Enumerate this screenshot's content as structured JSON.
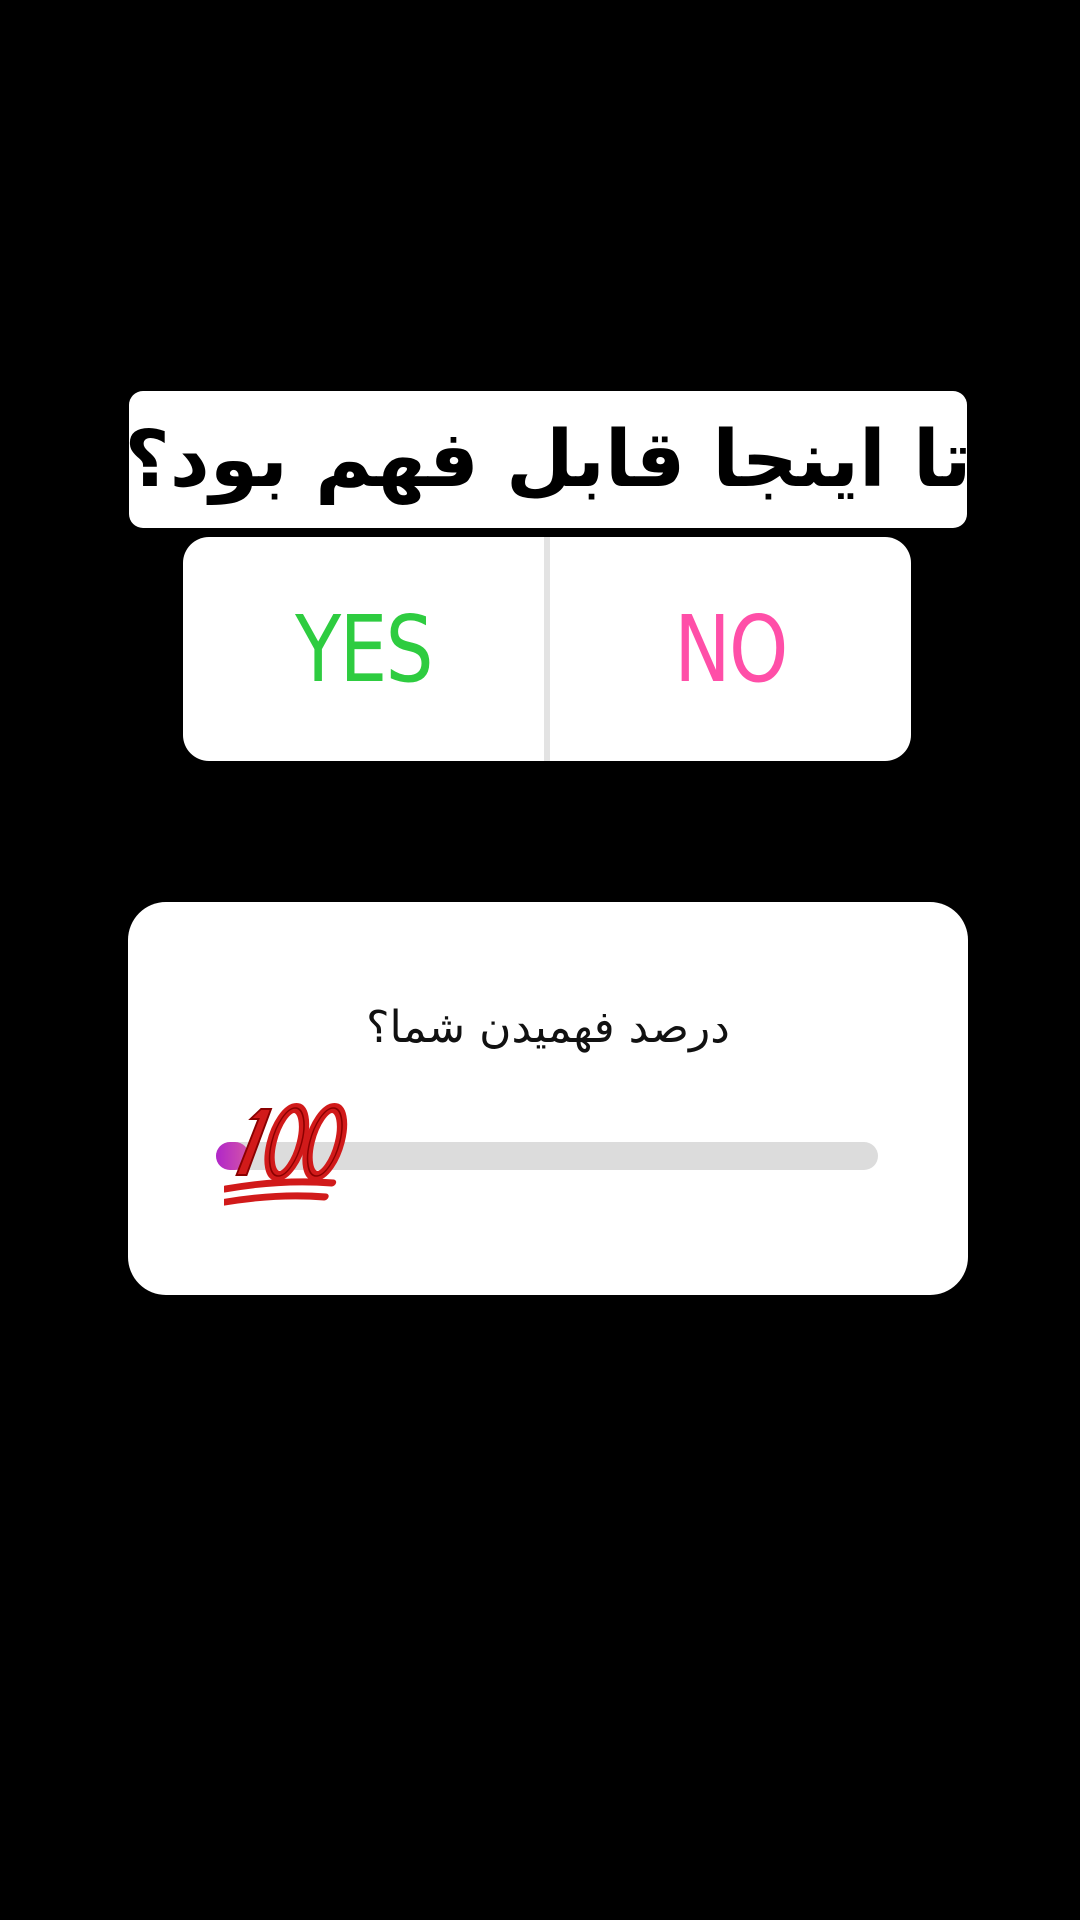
{
  "question": {
    "text": "تا اینجا قابل فهم بود؟"
  },
  "poll": {
    "yes_label": "YES",
    "no_label": "NO",
    "yes_color": "#2ecc40",
    "no_color": "#ff4fa8"
  },
  "slider": {
    "question": "درصد فهمیدن شما؟",
    "emoji": "hundred-points-emoji",
    "value": 0.05,
    "fill_color": "#b026c9"
  }
}
